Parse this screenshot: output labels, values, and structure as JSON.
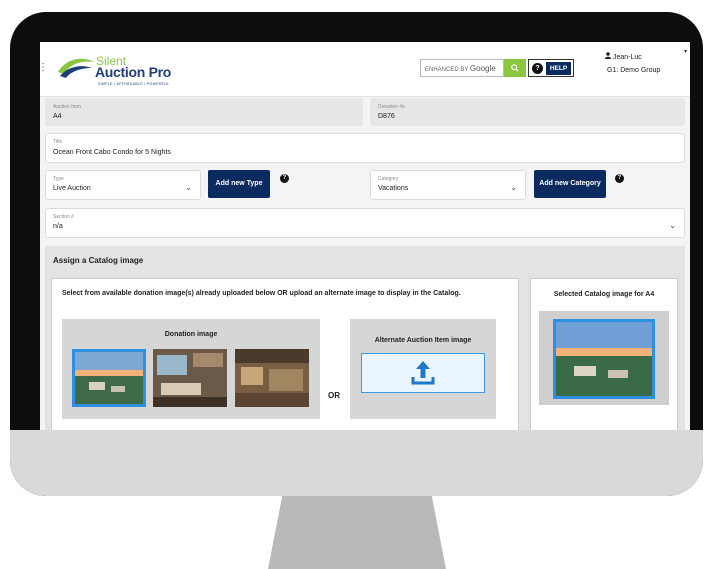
{
  "header": {
    "logo_top": "Silent",
    "logo_main": "Auction Pro",
    "logo_tagline": "SIMPLE • AFFORDABLE • POWERFUL",
    "search_prefix": "ENHANCED BY",
    "search_brand": "Google",
    "help_label": "HELP",
    "user_name": "Jean-Luc",
    "user_group": "G1: Demo Group"
  },
  "fields": {
    "auction_item": {
      "label": "Auction Item",
      "value": "A4"
    },
    "donation_num": {
      "label": "Donation #s",
      "value": "D876"
    },
    "title": {
      "label": "Title",
      "value": "Ocean Front Cabo Condo for 5 Nights"
    },
    "type": {
      "label": "Type",
      "value": "Live Auction"
    },
    "category": {
      "label": "Category",
      "value": "Vacations"
    },
    "section": {
      "label": "Section #",
      "value": "n/a"
    }
  },
  "buttons": {
    "add_type": "Add new Type",
    "add_category": "Add new Category"
  },
  "catalog": {
    "heading": "Assign a Catalog image",
    "instructions": "Select from available donation image(s) already uploaded below OR upload an alternate image to display in the Catalog.",
    "donation_image_label": "Donation image",
    "or_label": "OR",
    "alternate_label": "Alternate Auction Item image",
    "selected_label": "Selected Catalog image for A4"
  },
  "colors": {
    "brand_navy": "#0a2a60",
    "brand_green": "#8cc63f",
    "selection_blue": "#2f8fe0"
  }
}
